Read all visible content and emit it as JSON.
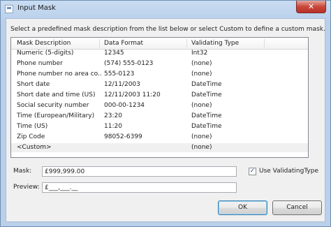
{
  "window": {
    "title": "Input Mask",
    "close_label": "✕"
  },
  "instructions": "Select a predefined mask description from the list below or select Custom to define a custom mask.",
  "list": {
    "columns": [
      "Mask Description",
      "Data Format",
      "Validating Type"
    ],
    "rows": [
      [
        "Numeric (5-digits)",
        "12345",
        "Int32"
      ],
      [
        "Phone number",
        "(574) 555-0123",
        "(none)"
      ],
      [
        "Phone number no area co...",
        "555-0123",
        "(none)"
      ],
      [
        "Short date",
        "12/11/2003",
        "DateTime"
      ],
      [
        "Short date and time (US)",
        "12/11/2003 11:20",
        "DateTime"
      ],
      [
        "Social security number",
        "000-00-1234",
        "(none)"
      ],
      [
        "Time (European/Military)",
        "23:20",
        "DateTime"
      ],
      [
        "Time (US)",
        "11:20",
        "DateTime"
      ],
      [
        "Zip Code",
        "98052-6399",
        "(none)"
      ],
      [
        "<Custom>",
        "",
        "(none)"
      ]
    ]
  },
  "mask": {
    "label": "Mask:",
    "value": "£999,999.00"
  },
  "preview": {
    "label": "Preview:",
    "value": "£___,___.__"
  },
  "use_validating_type": {
    "label": "Use ValidatingType",
    "checked": true,
    "check_glyph": "✓"
  },
  "buttons": {
    "ok": "OK",
    "cancel": "Cancel"
  }
}
